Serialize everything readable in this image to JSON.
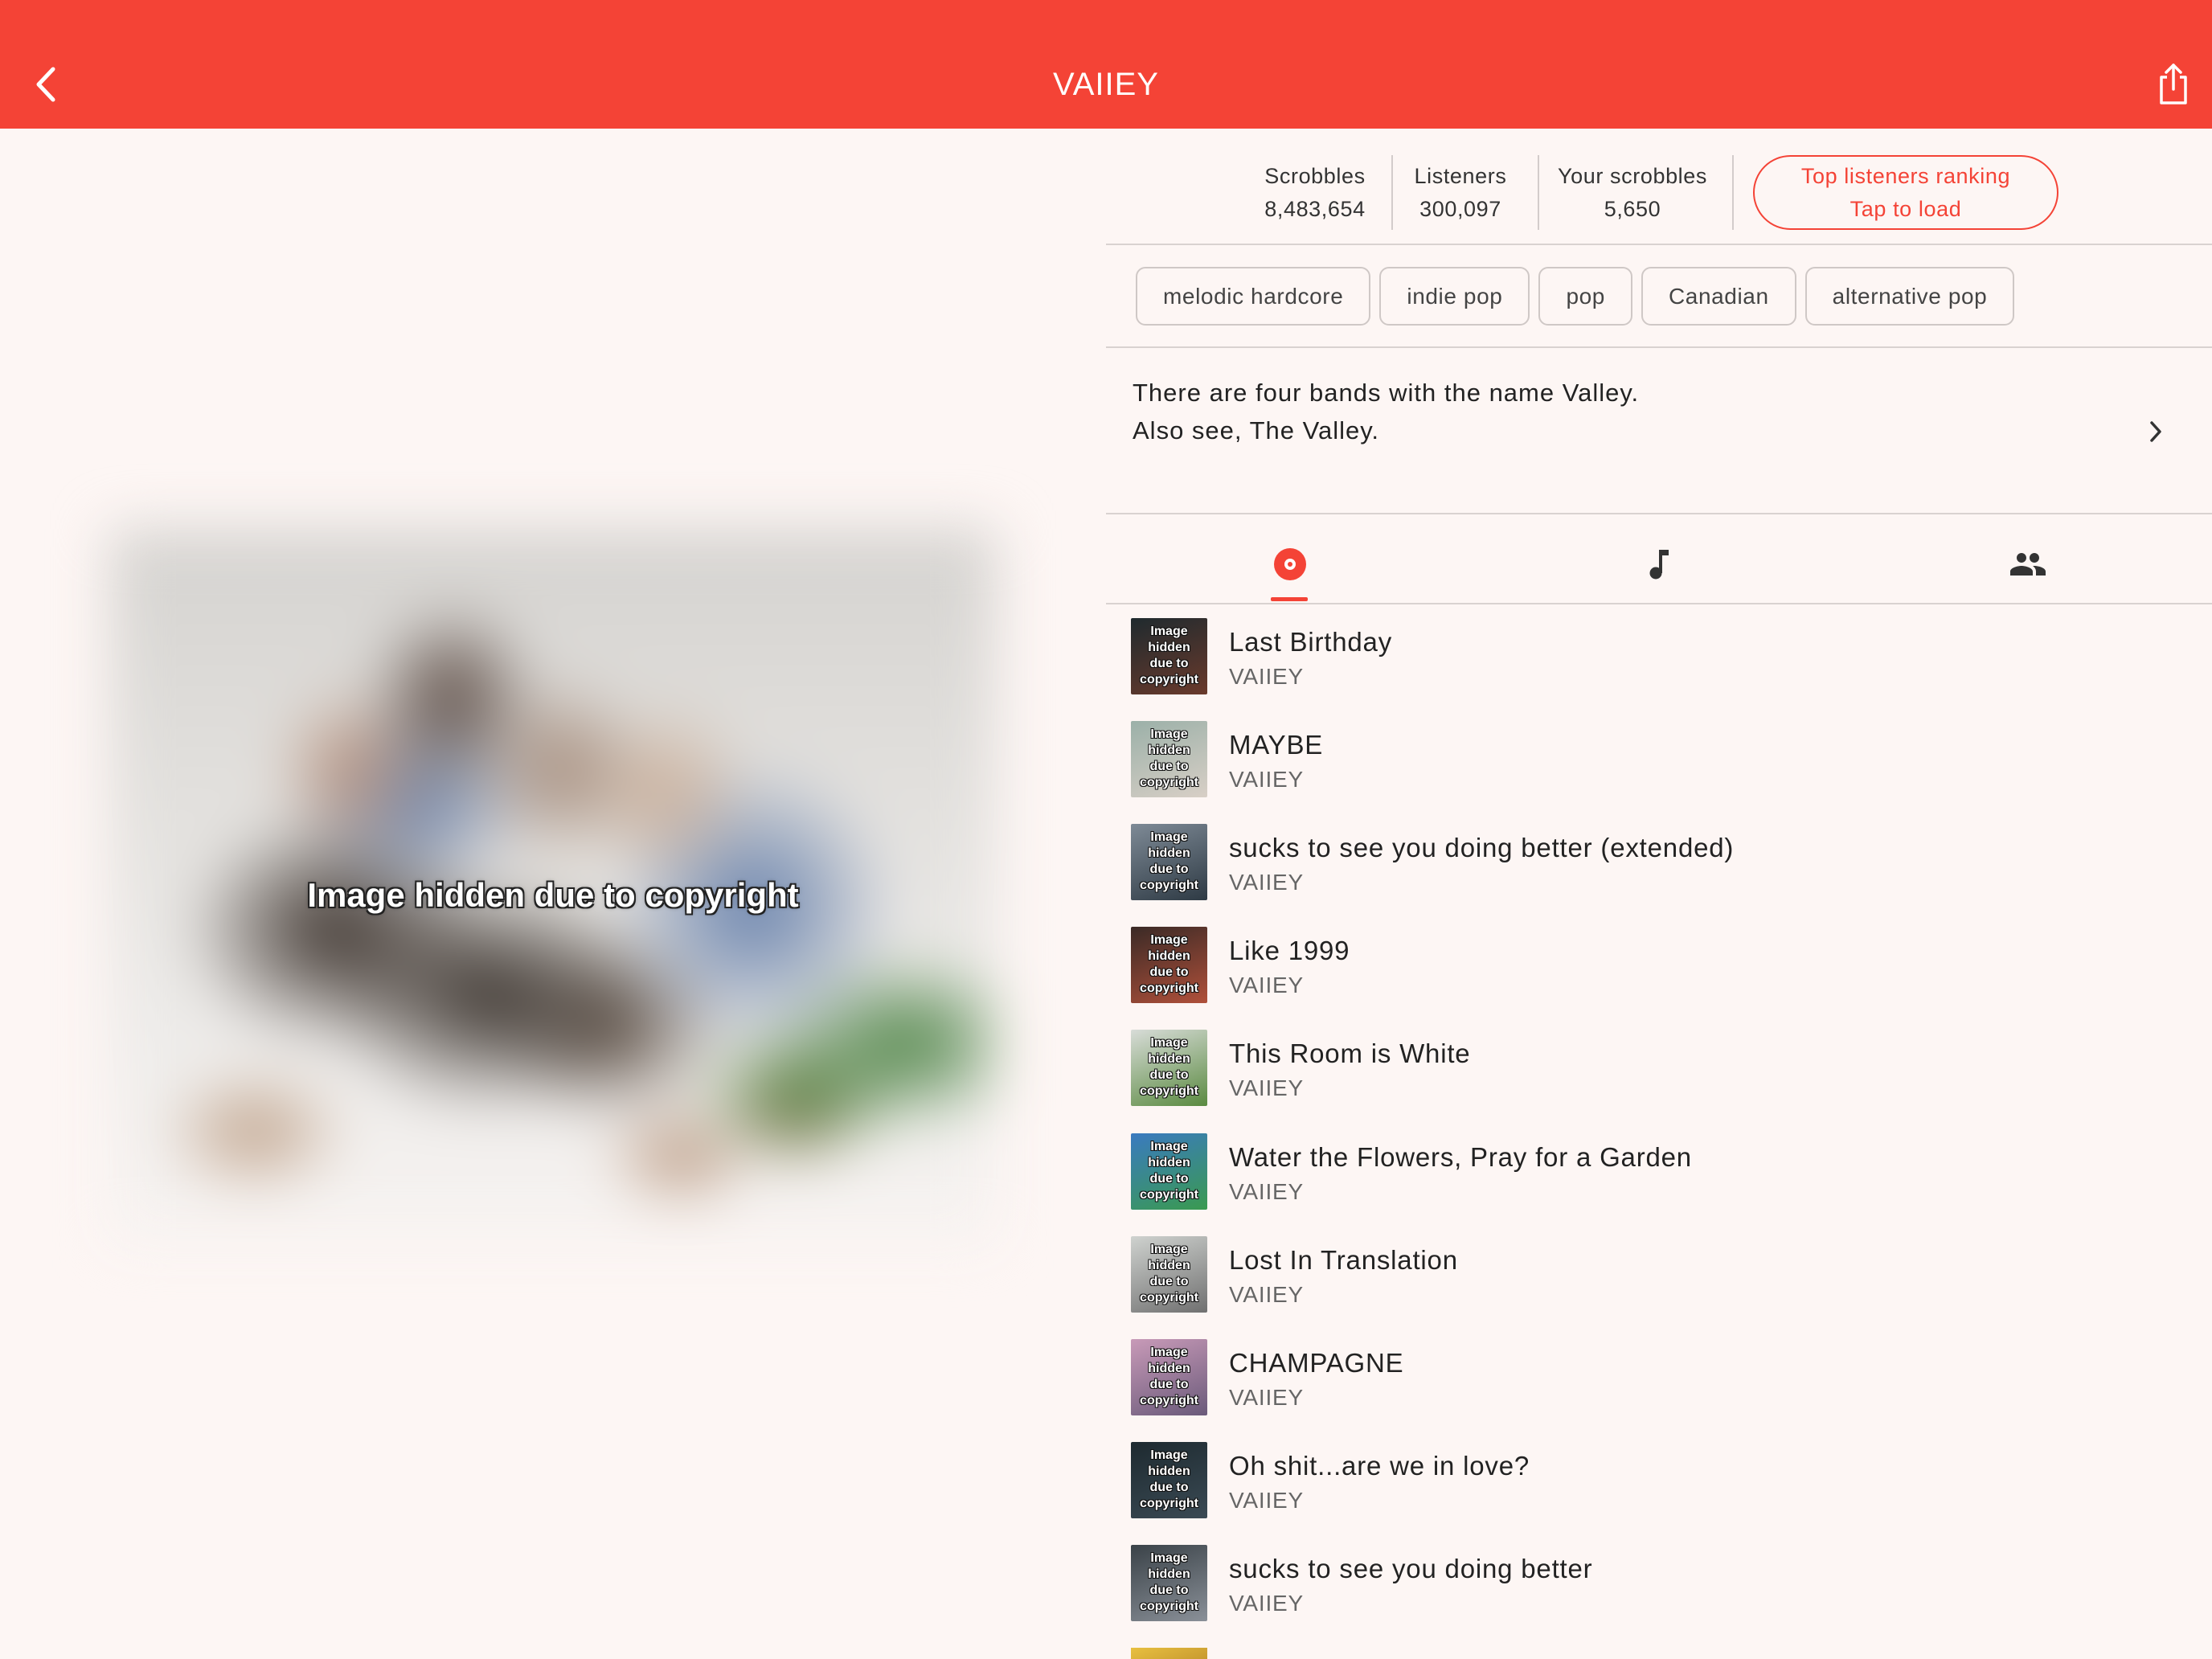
{
  "colors": {
    "accent": "#f44336",
    "background": "#fdf6f4",
    "text": "#222222",
    "muted": "#666666"
  },
  "header": {
    "title": "VAIIEY",
    "back_icon": "chevron-left-icon",
    "share_icon": "share-icon"
  },
  "artist_image": {
    "overlay_text": "Image hidden due to copyright"
  },
  "stats": [
    {
      "label": "Scrobbles",
      "value": "8,483,654"
    },
    {
      "label": "Listeners",
      "value": "300,097"
    },
    {
      "label": "Your scrobbles",
      "value": "5,650"
    }
  ],
  "top_listeners": {
    "line1": "Top listeners ranking",
    "line2": "Tap to load"
  },
  "tags": [
    "melodic hardcore",
    "indie pop",
    "pop",
    "Canadian",
    "alternative pop"
  ],
  "bio": {
    "line1": "There are four bands with the name Valley.",
    "line2": "Also see, The Valley.",
    "more_icon": "chevron-right-icon"
  },
  "tabs": [
    {
      "icon": "album-icon",
      "selected": true
    },
    {
      "icon": "music-note-icon",
      "selected": false
    },
    {
      "icon": "people-icon",
      "selected": false
    }
  ],
  "thumb_label": [
    "Image",
    "hidden",
    "due to",
    "copyright"
  ],
  "tracks": [
    {
      "title": "Last Birthday",
      "artist": "VAIIEY",
      "thumb_colors": [
        "#1f2a2e",
        "#6a3a2c"
      ]
    },
    {
      "title": "MAYBE",
      "artist": "VAIIEY",
      "thumb_colors": [
        "#9bb0a8",
        "#d8cfc6"
      ]
    },
    {
      "title": "sucks to see you doing better (extended)",
      "artist": "VAIIEY",
      "thumb_colors": [
        "#7e8a96",
        "#2e3a44"
      ]
    },
    {
      "title": "Like 1999",
      "artist": "VAIIEY",
      "thumb_colors": [
        "#3a2a26",
        "#b0503a"
      ]
    },
    {
      "title": "This Room is White",
      "artist": "VAIIEY",
      "thumb_colors": [
        "#d8dcd8",
        "#5a8a40"
      ]
    },
    {
      "title": "Water the Flowers, Pray for a Garden",
      "artist": "VAIIEY",
      "thumb_colors": [
        "#3a7ac0",
        "#3a9a50"
      ]
    },
    {
      "title": "Lost In Translation",
      "artist": "VAIIEY",
      "thumb_colors": [
        "#cfd2cf",
        "#707070"
      ]
    },
    {
      "title": "CHAMPAGNE",
      "artist": "VAIIEY",
      "thumb_colors": [
        "#c89ab8",
        "#6a5a7a"
      ]
    },
    {
      "title": "Oh shit...are we in love?",
      "artist": "VAIIEY",
      "thumb_colors": [
        "#1e2a30",
        "#3a4a54"
      ]
    },
    {
      "title": "sucks to see you doing better",
      "artist": "VAIIEY",
      "thumb_colors": [
        "#3a4248",
        "#8a9098"
      ]
    }
  ],
  "partial_item": {
    "thumb_colors": [
      "#e8c040",
      "#c89a30"
    ]
  }
}
